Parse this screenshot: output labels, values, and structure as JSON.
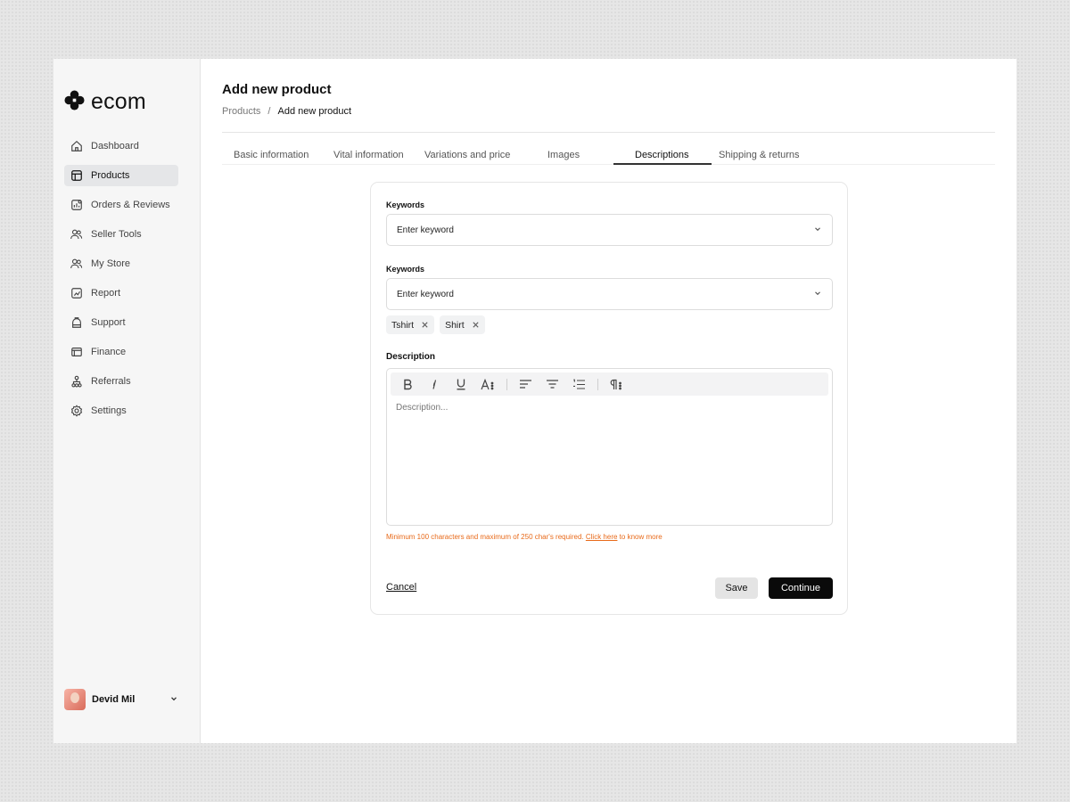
{
  "brand": {
    "name": "ecom"
  },
  "sidebar": {
    "items": [
      {
        "label": "Dashboard",
        "icon": "home-icon",
        "active": false
      },
      {
        "label": "Products",
        "icon": "products-icon",
        "active": true
      },
      {
        "label": "Orders & Reviews",
        "icon": "orders-icon",
        "active": false
      },
      {
        "label": "Seller Tools",
        "icon": "users-icon",
        "active": false
      },
      {
        "label": "My Store",
        "icon": "store-icon",
        "active": false
      },
      {
        "label": "Report",
        "icon": "report-icon",
        "active": false
      },
      {
        "label": "Support",
        "icon": "support-icon",
        "active": false
      },
      {
        "label": "Finance",
        "icon": "finance-icon",
        "active": false
      },
      {
        "label": "Referrals",
        "icon": "referrals-icon",
        "active": false
      },
      {
        "label": "Settings",
        "icon": "gear-icon",
        "active": false
      }
    ],
    "user": {
      "name": "Devid Mil"
    }
  },
  "header": {
    "title": "Add new product",
    "breadcrumb": {
      "parent": "Products",
      "separator": "/",
      "current": "Add new product"
    }
  },
  "tabs": [
    {
      "label": "Basic information",
      "active": false
    },
    {
      "label": "Vital information",
      "active": false
    },
    {
      "label": "Variations and price",
      "active": false
    },
    {
      "label": "Images",
      "active": false
    },
    {
      "label": "Descriptions",
      "active": true
    },
    {
      "label": "Shipping & returns",
      "active": false
    }
  ],
  "form": {
    "keywords_1": {
      "label": "Keywords",
      "placeholder": "Enter keyword"
    },
    "keywords_2": {
      "label": "Keywords",
      "placeholder": "Enter keyword"
    },
    "chips": [
      "Tshirt",
      "Shirt"
    ],
    "description": {
      "label": "Description",
      "placeholder": "Description...",
      "toolbar": [
        "bold-icon",
        "italic-icon",
        "underline-icon",
        "font-size-icon",
        "align-left-icon",
        "align-center-icon",
        "numbered-list-icon",
        "paragraph-icon"
      ]
    },
    "hint": {
      "text": "Minimum 100 characters and maximum of 250 char's required.",
      "link": "Click here",
      "suffix": "to know more"
    },
    "actions": {
      "cancel": "Cancel",
      "save": "Save",
      "continue": "Continue"
    }
  },
  "colors": {
    "accent": "#0a0a0a",
    "warning": "#e86a1a",
    "sidebar_bg": "#f6f6f6",
    "active_bg": "#e5e6e8"
  }
}
